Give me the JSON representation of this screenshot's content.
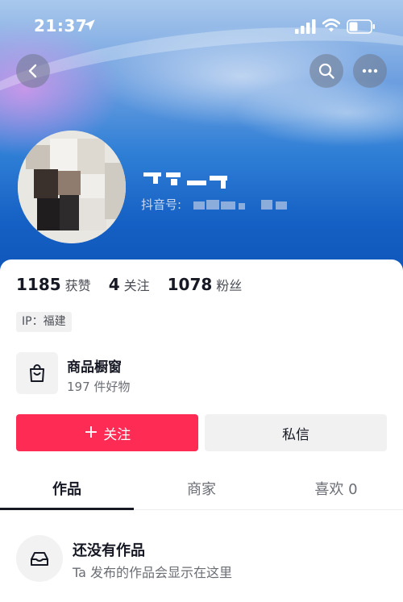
{
  "status_bar": {
    "time": "21:37"
  },
  "profile": {
    "douyin_id_label": "抖音号:"
  },
  "stats": [
    {
      "value": "1185",
      "label": "获赞"
    },
    {
      "value": "4",
      "label": "关注"
    },
    {
      "value": "1078",
      "label": "粉丝"
    }
  ],
  "ip_tag": "IP：福建",
  "shop": {
    "title": "商品橱窗",
    "subtitle": "197 件好物"
  },
  "actions": {
    "follow_label": "关注",
    "follow_plus": "+",
    "message_label": "私信"
  },
  "tabs": [
    {
      "label": "作品",
      "active": true
    },
    {
      "label": "商家",
      "active": false
    },
    {
      "label": "喜欢 0",
      "active": false
    }
  ],
  "empty_state": {
    "title": "还没有作品",
    "subtitle": "Ta 发布的作品会显示在这里"
  },
  "colors": {
    "accent": "#fe2c55",
    "header_blue": "#1560c4"
  }
}
